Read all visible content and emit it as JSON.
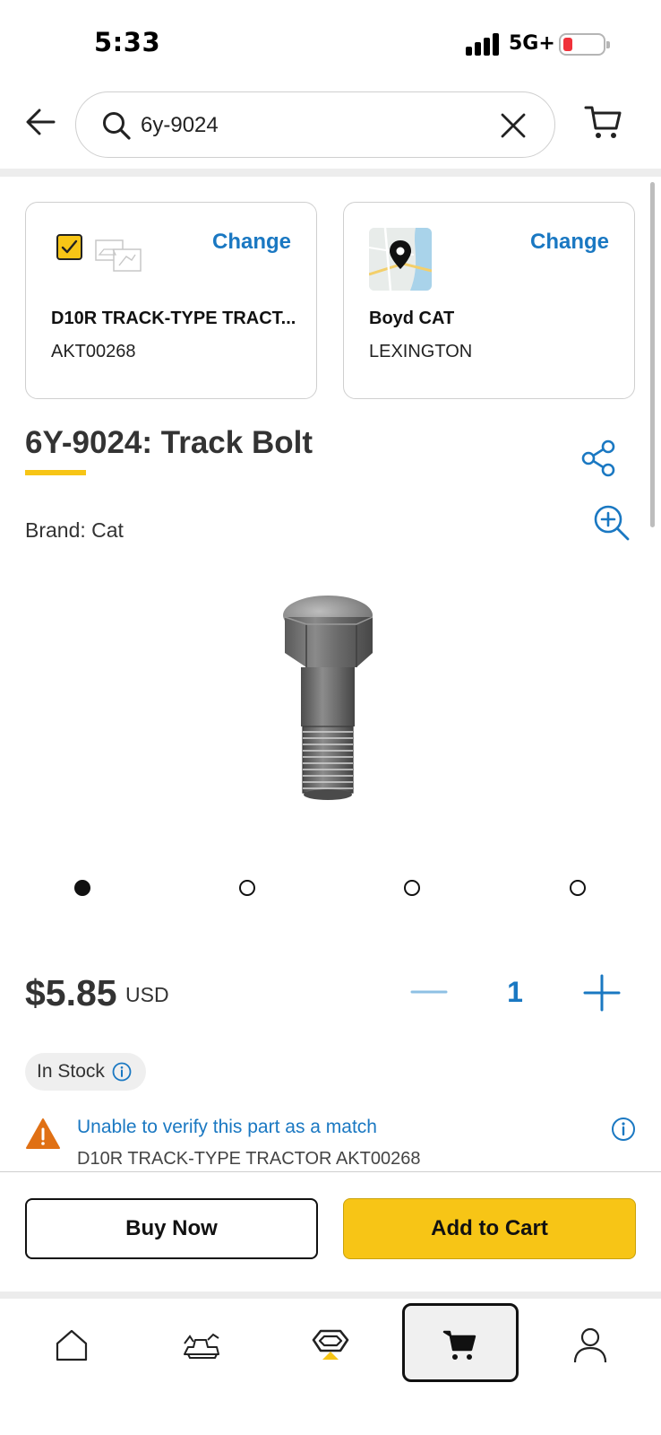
{
  "status_bar": {
    "time": "5:33",
    "network": "5G+",
    "battery_color": "#f0313a"
  },
  "header": {
    "search": {
      "value": "6y-9024",
      "placeholder": ""
    },
    "icons": [
      "back-arrow-icon",
      "search-icon",
      "close-icon",
      "cart-icon"
    ]
  },
  "equipment_card": {
    "change_label": "Change",
    "title": "D10R TRACK-TYPE TRACT...",
    "serial": "AKT00268",
    "checked": true
  },
  "dealer_card": {
    "change_label": "Change",
    "name": "Boyd CAT",
    "location": "LEXINGTON"
  },
  "product": {
    "title": "6Y-9024: Track Bolt",
    "brand": "Brand: Cat",
    "image_count": 4,
    "active_image_index": 0
  },
  "pricing": {
    "price": "$5.85",
    "currency": "USD",
    "quantity": "1"
  },
  "stock": {
    "label": "In Stock"
  },
  "compatibility_warning": {
    "message": "Unable to verify this part as a match",
    "detail": "D10R TRACK-TYPE TRACTOR AKT00268"
  },
  "actions": {
    "buy_now": "Buy Now",
    "add_to_cart": "Add to Cart"
  },
  "bottom_nav": {
    "items": [
      "home-icon",
      "equipment-icon",
      "cat-logo-icon",
      "cart-icon",
      "account-icon"
    ],
    "active": "cart-icon"
  },
  "colors": {
    "accent_yellow": "#f7c516",
    "link_blue": "#1a78c2",
    "warning_orange": "#e07014"
  }
}
